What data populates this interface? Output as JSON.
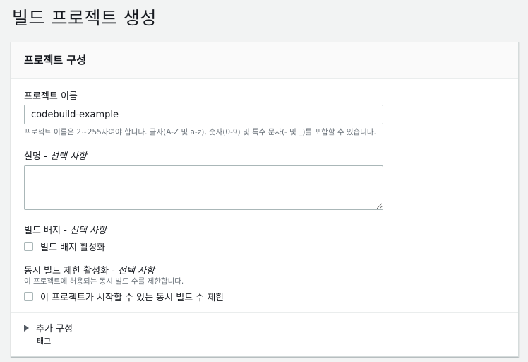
{
  "page": {
    "title": "빌드 프로젝트 생성"
  },
  "panel": {
    "title": "프로젝트 구성",
    "project_name": {
      "label": "프로젝트 이름",
      "value": "codebuild-example",
      "hint": "프로젝트 이름은 2~255자여야 합니다. 글자(A-Z 및 a-z), 숫자(0-9) 및 특수 문자(- 및 _)를 포함할 수 있습니다."
    },
    "description": {
      "label": "설명",
      "optional": "선택 사항",
      "value": ""
    },
    "build_badge": {
      "label": "빌드 배지",
      "optional": "선택 사항",
      "checkbox_label": "빌드 배지 활성화",
      "checked": false
    },
    "concurrent_limit": {
      "label": "동시 빌드 제한 활성화",
      "optional": "선택 사항",
      "hint": "이 프로젝트에 허용되는 동시 빌드 수를 제한합니다.",
      "checkbox_label": "이 프로젝트가 시작할 수 있는 동시 빌드 수 제한",
      "checked": false
    },
    "additional_config": {
      "label": "추가 구성",
      "sub": "태그",
      "expanded": false
    }
  }
}
